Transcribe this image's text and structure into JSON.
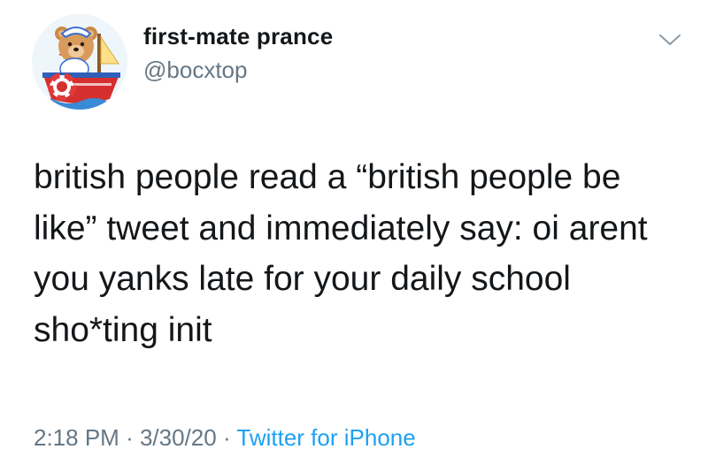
{
  "tweet": {
    "author": {
      "display_name": "first-mate prance",
      "handle": "@bocxtop",
      "avatar_icon": "teddy-bear-sailor-boat-avatar"
    },
    "menu_icon": "chevron-down-icon",
    "text": "british people read a “british people be like” tweet and immediately say: oi arent you yanks late for your daily school sho*ting init",
    "time": "2:18 PM",
    "separator": "·",
    "date": "3/30/20",
    "source": "Twitter for iPhone"
  },
  "colors": {
    "text": "#14171a",
    "secondary": "#657786",
    "link": "#1da1f2",
    "background": "#ffffff"
  }
}
